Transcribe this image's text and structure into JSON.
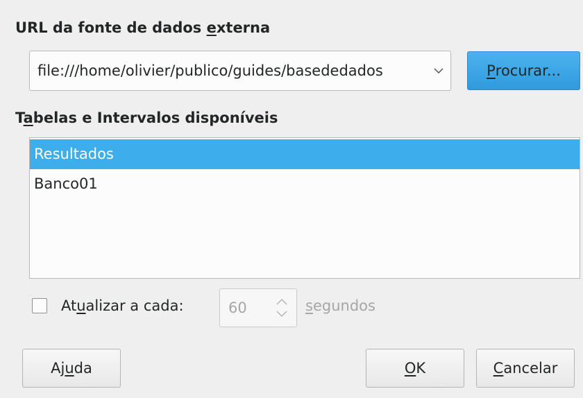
{
  "dialog": {
    "url_section": {
      "title_before": "URL da fonte de dados ",
      "title_mnemonic": "e",
      "title_after": "xterna",
      "url_value": "file:///home/olivier/publico/guides/basededados",
      "browse_button": {
        "mnemonic": "P",
        "rest": "rocurar..."
      }
    },
    "tables_section": {
      "title_before": "T",
      "title_mnemonic": "a",
      "title_after": "belas e Intervalos disponíveis",
      "items": [
        "Resultados",
        "Banco01"
      ],
      "selected_index": 0
    },
    "refresh": {
      "checked": false,
      "label_before": "At",
      "label_mnemonic": "u",
      "label_after": "alizar a cada:",
      "interval_value": "60",
      "unit_mnemonic": "s",
      "unit_rest": "egundos"
    },
    "buttons": {
      "help_before": "Aj",
      "help_mnemonic": "u",
      "help_after": "da",
      "ok_mnemonic": "O",
      "ok_rest": "K",
      "cancel_mnemonic": "C",
      "cancel_rest": "ancelar"
    }
  },
  "icons": {
    "dropdown": "chevron-down-icon",
    "spinner": "spin-up-down-icon"
  },
  "colors": {
    "background": "#efefef",
    "accent": "#3daee9",
    "text": "#232627",
    "disabled_text": "#a5a6a7"
  }
}
